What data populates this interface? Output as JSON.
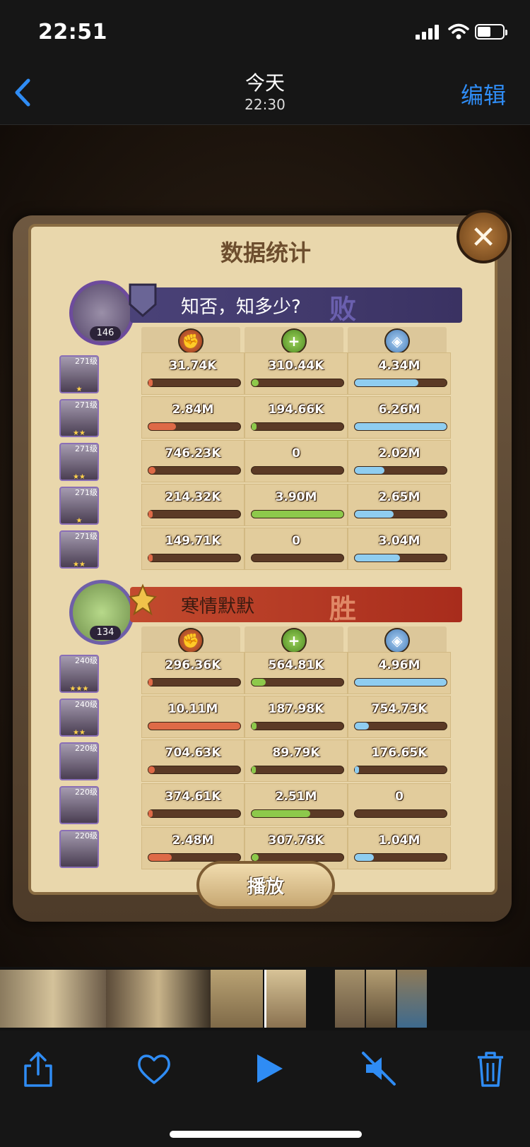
{
  "status_bar": {
    "time": "22:51"
  },
  "nav": {
    "title": "今天",
    "subtitle": "22:30",
    "edit_label": "编辑"
  },
  "panel": {
    "title": "数据统计",
    "teams": [
      {
        "player_name": "知否，知多少?",
        "result": "败",
        "avatar_level": "146",
        "accent_color": "#3e3566",
        "heroes": [
          {
            "level": "271级",
            "stars": "★",
            "dmg": "31.74K",
            "heal": "310.44K",
            "tank": "4.34M",
            "dmg_pct": 0.03,
            "heal_pct": 0.08,
            "tank_pct": 0.69
          },
          {
            "level": "271级",
            "stars": "★★",
            "dmg": "2.84M",
            "heal": "194.66K",
            "tank": "6.26M",
            "dmg_pct": 0.3,
            "heal_pct": 0.05,
            "tank_pct": 1.0
          },
          {
            "level": "271级",
            "stars": "★★",
            "dmg": "746.23K",
            "heal": "0",
            "tank": "2.02M",
            "dmg_pct": 0.08,
            "heal_pct": 0.0,
            "tank_pct": 0.32
          },
          {
            "level": "271级",
            "stars": "★",
            "dmg": "214.32K",
            "heal": "3.90M",
            "tank": "2.65M",
            "dmg_pct": 0.02,
            "heal_pct": 1.0,
            "tank_pct": 0.42
          },
          {
            "level": "271级",
            "stars": "★★",
            "dmg": "149.71K",
            "heal": "0",
            "tank": "3.04M",
            "dmg_pct": 0.02,
            "heal_pct": 0.0,
            "tank_pct": 0.49
          }
        ]
      },
      {
        "player_name": "寒情默默",
        "result": "胜",
        "avatar_level": "134",
        "accent_color": "#b7321f",
        "heroes": [
          {
            "level": "240级",
            "stars": "★★★",
            "dmg": "296.36K",
            "heal": "564.81K",
            "tank": "4.96M",
            "dmg_pct": 0.03,
            "heal_pct": 0.15,
            "tank_pct": 1.0
          },
          {
            "level": "240级",
            "stars": "★★",
            "dmg": "10.11M",
            "heal": "187.98K",
            "tank": "754.73K",
            "dmg_pct": 1.0,
            "heal_pct": 0.05,
            "tank_pct": 0.15
          },
          {
            "level": "220级",
            "stars": "",
            "dmg": "704.63K",
            "heal": "89.79K",
            "tank": "176.65K",
            "dmg_pct": 0.07,
            "heal_pct": 0.03,
            "tank_pct": 0.04
          },
          {
            "level": "220级",
            "stars": "",
            "dmg": "374.61K",
            "heal": "2.51M",
            "tank": "0",
            "dmg_pct": 0.04,
            "heal_pct": 0.64,
            "tank_pct": 0.0
          },
          {
            "level": "220级",
            "stars": "",
            "dmg": "2.48M",
            "heal": "307.78K",
            "tank": "1.04M",
            "dmg_pct": 0.25,
            "heal_pct": 0.08,
            "tank_pct": 0.21
          }
        ]
      }
    ],
    "play_label": "播放",
    "bar_colors": {
      "dmg": "#de6a47",
      "heal": "#8dc94b",
      "tank": "#8fcdf0"
    }
  }
}
